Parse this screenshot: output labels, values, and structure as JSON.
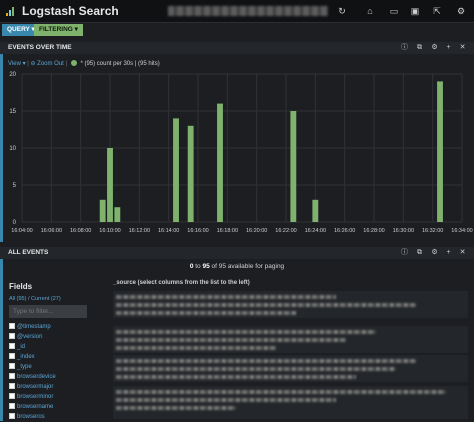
{
  "app": {
    "title": "Logstash Search"
  },
  "topbar": {
    "icons": [
      "refresh-icon",
      "home-icon",
      "folder-icon",
      "save-icon",
      "share-icon",
      "settings-icon"
    ]
  },
  "query_bar": {
    "query_label": "QUERY ▾",
    "filter_label": "FILTERING ▾"
  },
  "events_over_time": {
    "title": "EVENTS OVER TIME",
    "view_label": "View ▾",
    "zoom_label": "⊖ Zoom Out",
    "legend_text": "* (95)   count per 30s | (95 hits)"
  },
  "chart_data": {
    "type": "bar",
    "categories": [
      "16:09:30",
      "16:10:00",
      "16:10:30",
      "16:14:30",
      "16:15:30",
      "16:17:30",
      "16:22:30",
      "16:24:00",
      "16:32:30"
    ],
    "values": [
      3,
      10,
      2,
      14,
      13,
      16,
      15,
      3,
      19
    ],
    "x_ticks": [
      "16:04:00",
      "16:06:00",
      "16:08:00",
      "16:10:00",
      "16:12:00",
      "16:14:00",
      "16:16:00",
      "16:18:00",
      "16:20:00",
      "16:22:00",
      "16:24:00",
      "16:26:00",
      "16:28:00",
      "16:30:00",
      "16:32:00",
      "16:34:00"
    ],
    "y_ticks": [
      "0",
      "5",
      "10",
      "15",
      "20"
    ],
    "ylim": [
      0,
      20
    ],
    "xrange": [
      "16:04:00",
      "16:34:00"
    ],
    "grid": true,
    "bar_color": "#7eb26d"
  },
  "all_events": {
    "title": "ALL EVENTS",
    "paging_from": "0",
    "paging_to": "95",
    "paging_text": "of 95 available for paging",
    "fields_title": "Fields",
    "fields_sub": "All (95) / Current (27)",
    "filter_placeholder": "Type to filter...",
    "fields": [
      "@timestamp",
      "@version",
      "_id",
      "_index",
      "_type",
      "browserdevice",
      "browsermajor",
      "browserminor",
      "browsername",
      "browseros"
    ],
    "source_header": "_source (select columns from the list to the left)"
  },
  "colors": {
    "accent_blue": "#3a87ad",
    "accent_green": "#7eb26d",
    "link": "#5aa7d6"
  }
}
